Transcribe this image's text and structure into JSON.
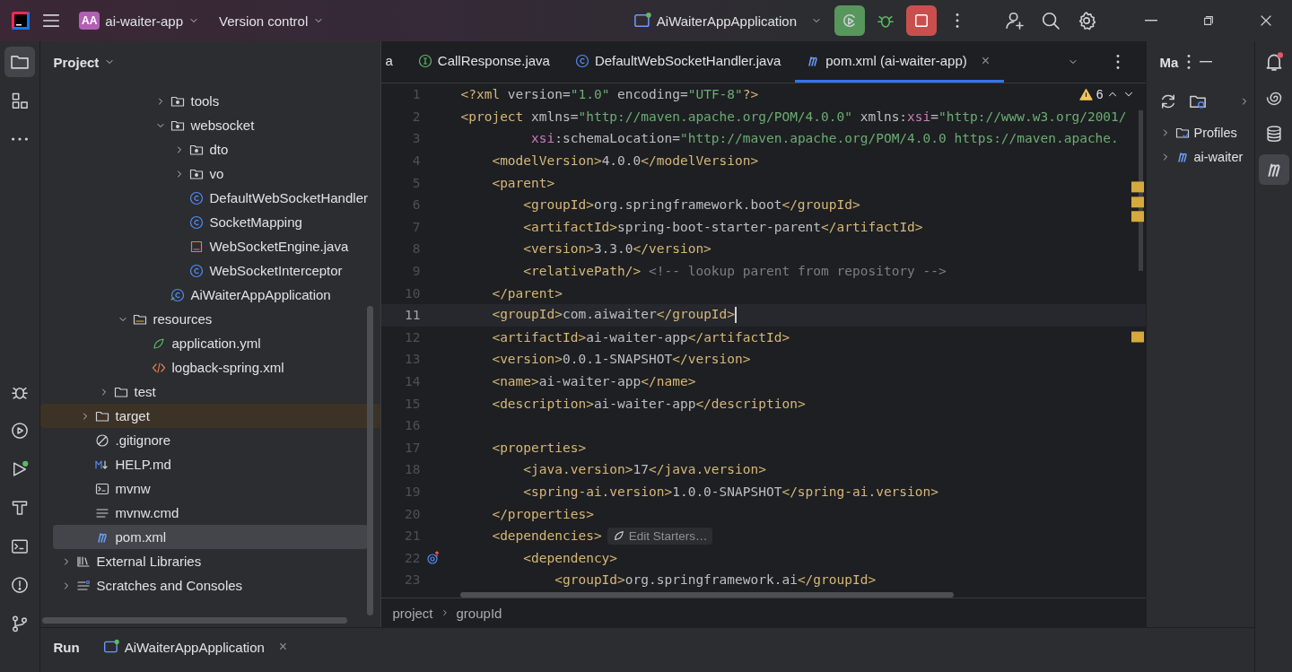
{
  "title_bar": {
    "project_badge": "AA",
    "project": "ai-waiter-app",
    "vcs": "Version control",
    "run_config": "AiWaiterAppApplication"
  },
  "left_toolbar": [
    {
      "kind": "folder",
      "selected": true
    },
    {
      "kind": "structure",
      "selected": false
    },
    {
      "kind": "more",
      "selected": false
    },
    {
      "kind": "debug",
      "selected": false
    },
    {
      "kind": "services",
      "selected": false
    },
    {
      "kind": "run",
      "selected": false
    },
    {
      "kind": "build",
      "selected": false
    },
    {
      "kind": "terminal",
      "selected": false
    },
    {
      "kind": "problems",
      "selected": false
    },
    {
      "kind": "git",
      "selected": false
    }
  ],
  "project_panel": {
    "title": "Project",
    "segments": [
      {
        "items": [
          {
            "label": "tools",
            "kind": "package",
            "expanded": false,
            "selected": false,
            "excluded": false
          },
          {
            "label": "websocket",
            "kind": "package",
            "expanded": true,
            "selected": false,
            "excluded": false,
            "children": [
              {
                "label": "dto",
                "kind": "package",
                "expanded": false,
                "selected": false,
                "excluded": false
              },
              {
                "label": "vo",
                "kind": "package",
                "expanded": false,
                "selected": false,
                "excluded": false
              },
              {
                "label": "DefaultWebSocketHandler",
                "kind": "class",
                "selected": false,
                "excluded": false
              },
              {
                "label": "SocketMapping",
                "kind": "class",
                "selected": false,
                "excluded": false
              },
              {
                "label": "WebSocketEngine.java",
                "kind": "java",
                "selected": false,
                "excluded": false
              },
              {
                "label": "WebSocketInterceptor",
                "kind": "class",
                "selected": false,
                "excluded": false
              }
            ]
          },
          {
            "label": "AiWaiterAppApplication",
            "kind": "app",
            "selected": false,
            "excluded": false
          }
        ]
      },
      {
        "items": [
          {
            "label": "resources",
            "kind": "resources",
            "expanded": true,
            "selected": false,
            "excluded": false,
            "children": [
              {
                "label": "application.yml",
                "kind": "yml",
                "selected": false,
                "excluded": false
              },
              {
                "label": "logback-spring.xml",
                "kind": "xml",
                "selected": false,
                "excluded": false
              }
            ]
          }
        ]
      },
      {
        "items": [
          {
            "label": "test",
            "kind": "folder",
            "expanded": false,
            "selected": false,
            "excluded": false
          }
        ]
      },
      {
        "items": [
          {
            "label": "target",
            "kind": "folder",
            "expanded": false,
            "selected": false,
            "excluded": true
          },
          {
            "label": ".gitignore",
            "kind": "ignore",
            "selected": false,
            "excluded": false
          },
          {
            "label": "HELP.md",
            "kind": "markdown",
            "selected": false,
            "excluded": false
          },
          {
            "label": "mvnw",
            "kind": "shell",
            "selected": false,
            "excluded": false
          },
          {
            "label": "mvnw.cmd",
            "kind": "text",
            "selected": false,
            "excluded": false
          },
          {
            "label": "pom.xml",
            "kind": "maven",
            "selected": true,
            "excluded": false
          }
        ]
      },
      {
        "items": [
          {
            "label": "External Libraries",
            "kind": "library",
            "expanded": false,
            "selected": false,
            "excluded": false
          },
          {
            "label": "Scratches and Consoles",
            "kind": "scratches",
            "expanded": false,
            "selected": false,
            "excluded": false
          }
        ]
      }
    ]
  },
  "editor": {
    "tabs": [
      {
        "label": "a",
        "kind": "none",
        "selected": false
      },
      {
        "label": "CallResponse.java",
        "kind": "interface",
        "selected": false
      },
      {
        "label": "DefaultWebSocketHandler.java",
        "kind": "class",
        "selected": false
      },
      {
        "label": "pom.xml (ai-waiter-app)",
        "kind": "maven",
        "selected": true,
        "close": "×"
      }
    ],
    "warnings": "6",
    "lines": [
      {
        "number": "1",
        "current": false,
        "gutter_mark": false,
        "tokens": [
          {
            "kind": "tag",
            "text": "<?xml"
          },
          {
            "kind": "attr",
            "text": " version="
          },
          {
            "kind": "value",
            "text": "\"1.0\""
          },
          {
            "kind": "attr",
            "text": " encoding="
          },
          {
            "kind": "value",
            "text": "\"UTF-8\""
          },
          {
            "kind": "tag",
            "text": "?>"
          }
        ]
      },
      {
        "number": "2",
        "current": false,
        "gutter_mark": false,
        "tokens": [
          {
            "kind": "tag",
            "text": "<project"
          },
          {
            "kind": "attr",
            "text": " xmlns="
          },
          {
            "kind": "value",
            "text": "\"http://maven.apache.org/POM/4.0.0\""
          },
          {
            "kind": "attr",
            "text": " xmlns:"
          },
          {
            "kind": "ns",
            "text": "xsi"
          },
          {
            "kind": "attr",
            "text": "="
          },
          {
            "kind": "value",
            "text": "\"http://www.w3.org/2001/"
          }
        ]
      },
      {
        "number": "3",
        "current": false,
        "gutter_mark": false,
        "tokens": [
          {
            "kind": "ns",
            "text": "         xsi"
          },
          {
            "kind": "attr",
            "text": ":schemaLocation="
          },
          {
            "kind": "value",
            "text": "\"http://maven.apache.org/POM/4.0.0 https://maven.apache."
          }
        ]
      },
      {
        "number": "4",
        "current": false,
        "gutter_mark": false,
        "tokens": [
          {
            "kind": "tag",
            "text": "    <modelVersion>"
          },
          {
            "kind": "text",
            "text": "4.0.0"
          },
          {
            "kind": "tag",
            "text": "</modelVersion>"
          }
        ]
      },
      {
        "number": "5",
        "current": false,
        "gutter_mark": false,
        "tokens": [
          {
            "kind": "tag",
            "text": "    <parent>"
          }
        ]
      },
      {
        "number": "6",
        "current": false,
        "gutter_mark": false,
        "tokens": [
          {
            "kind": "tag",
            "text": "        <groupId>"
          },
          {
            "kind": "text",
            "text": "org.springframework.boot"
          },
          {
            "kind": "tag",
            "text": "</groupId>"
          }
        ]
      },
      {
        "number": "7",
        "current": false,
        "gutter_mark": false,
        "tokens": [
          {
            "kind": "tag",
            "text": "        <artifactId>"
          },
          {
            "kind": "text",
            "text": "spring-boot-starter-parent"
          },
          {
            "kind": "tag",
            "text": "</artifactId>"
          }
        ]
      },
      {
        "number": "8",
        "current": false,
        "gutter_mark": false,
        "tokens": [
          {
            "kind": "tag",
            "text": "        <version>"
          },
          {
            "kind": "text",
            "text": "3.3.0"
          },
          {
            "kind": "tag",
            "text": "</version>"
          }
        ]
      },
      {
        "number": "9",
        "current": false,
        "gutter_mark": false,
        "tokens": [
          {
            "kind": "tag",
            "text": "        <relativePath/>"
          },
          {
            "kind": "comment",
            "text": " <!-- lookup parent from repository -->"
          }
        ]
      },
      {
        "number": "10",
        "current": false,
        "gutter_mark": false,
        "tokens": [
          {
            "kind": "tag",
            "text": "    </parent>"
          }
        ]
      },
      {
        "number": "11",
        "current": true,
        "gutter_mark": false,
        "tokens": [
          {
            "kind": "tag",
            "text": "    <groupId>"
          },
          {
            "kind": "text",
            "text": "com.aiwaiter"
          },
          {
            "kind": "tag",
            "text": "</groupId>"
          }
        ]
      },
      {
        "number": "12",
        "current": false,
        "gutter_mark": false,
        "tokens": [
          {
            "kind": "tag",
            "text": "    <artifactId>"
          },
          {
            "kind": "text",
            "text": "ai-waiter-app"
          },
          {
            "kind": "tag",
            "text": "</artifactId>"
          }
        ]
      },
      {
        "number": "13",
        "current": false,
        "gutter_mark": false,
        "tokens": [
          {
            "kind": "tag",
            "text": "    <version>"
          },
          {
            "kind": "text",
            "text": "0.0.1-SNAPSHOT"
          },
          {
            "kind": "tag",
            "text": "</version>"
          }
        ]
      },
      {
        "number": "14",
        "current": false,
        "gutter_mark": false,
        "tokens": [
          {
            "kind": "tag",
            "text": "    <name>"
          },
          {
            "kind": "text",
            "text": "ai-waiter-app"
          },
          {
            "kind": "tag",
            "text": "</name>"
          }
        ]
      },
      {
        "number": "15",
        "current": false,
        "gutter_mark": false,
        "tokens": [
          {
            "kind": "tag",
            "text": "    <description>"
          },
          {
            "kind": "text",
            "text": "ai-waiter-app"
          },
          {
            "kind": "tag",
            "text": "</description>"
          }
        ]
      },
      {
        "number": "16",
        "current": false,
        "gutter_mark": false
      },
      {
        "number": "17",
        "current": false,
        "gutter_mark": false,
        "tokens": [
          {
            "kind": "tag",
            "text": "    <properties>"
          }
        ]
      },
      {
        "number": "18",
        "current": false,
        "gutter_mark": false,
        "tokens": [
          {
            "kind": "tag",
            "text": "        <java.version>"
          },
          {
            "kind": "text",
            "text": "17"
          },
          {
            "kind": "tag",
            "text": "</java.version>"
          }
        ]
      },
      {
        "number": "19",
        "current": false,
        "gutter_mark": false,
        "tokens": [
          {
            "kind": "tag",
            "text": "        <spring-ai.version>"
          },
          {
            "kind": "text",
            "text": "1.0.0-SNAPSHOT"
          },
          {
            "kind": "tag",
            "text": "</spring-ai.version>"
          }
        ]
      },
      {
        "number": "20",
        "current": false,
        "gutter_mark": false,
        "tokens": [
          {
            "kind": "tag",
            "text": "    </properties>"
          }
        ]
      },
      {
        "number": "21",
        "current": false,
        "gutter_mark": false,
        "tokens": [
          {
            "kind": "tag",
            "text": "    <dependencies>"
          }
        ],
        "hint": "Edit Starters…"
      },
      {
        "number": "22",
        "current": false,
        "gutter_mark": true,
        "tokens": [
          {
            "kind": "tag",
            "text": "        <dependency>"
          }
        ]
      },
      {
        "number": "23",
        "current": false,
        "gutter_mark": false,
        "tokens": [
          {
            "kind": "tag",
            "text": "            <groupId>"
          },
          {
            "kind": "text",
            "text": "org.springframework.ai"
          },
          {
            "kind": "tag",
            "text": "</groupId>"
          }
        ]
      }
    ],
    "breadcrumbs": [
      "project",
      "groupId"
    ]
  },
  "maven_panel": {
    "title": "Ma",
    "items": [
      {
        "label": "Profiles",
        "kind": "profiles",
        "expanded": false
      },
      {
        "label": "ai-waiter",
        "kind": "maven",
        "expanded": false
      }
    ]
  },
  "right_toolbar": [
    {
      "kind": "notifications",
      "selected": false
    },
    {
      "kind": "assistant",
      "selected": false
    },
    {
      "kind": "database",
      "selected": false
    },
    {
      "kind": "maven",
      "selected": true
    }
  ],
  "bottom_bar": {
    "title": "Run",
    "tab": "AiWaiterAppApplication",
    "close": "×"
  }
}
